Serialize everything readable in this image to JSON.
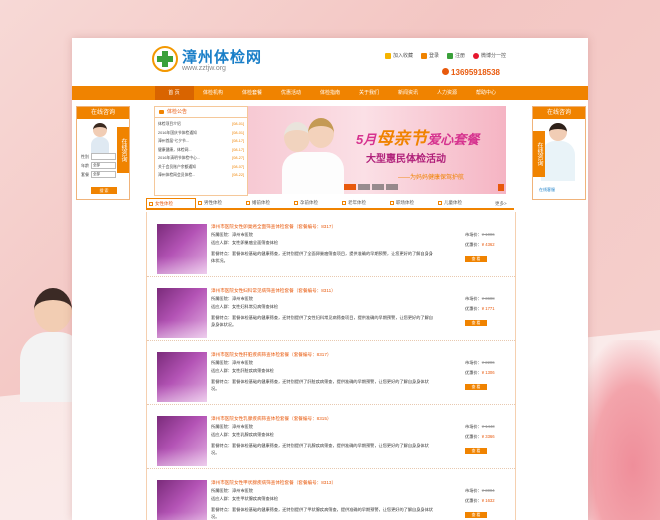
{
  "site": {
    "name": "漳州体检网",
    "url": "www.zztjw.org",
    "hotline": "13695918538",
    "top_links": [
      "加入收藏",
      "登录",
      "注册",
      "微博分一控"
    ]
  },
  "nav": [
    "首 页",
    "体检机构",
    "体检套餐",
    "优惠活动",
    "体检指南",
    "关于我们",
    "新闻资讯",
    "人力资源",
    "帮助中心"
  ],
  "side_left": {
    "title": "在线咨询",
    "tab": "在线咨询",
    "form_labels": [
      "性别",
      "年龄",
      "套餐"
    ],
    "form_values": [
      "",
      "全部",
      "全部"
    ],
    "button": "搜 索"
  },
  "side_right": {
    "title": "在线咨询",
    "tab": "在线咨询",
    "caption": "在线客服"
  },
  "notice": {
    "title": "体检公告",
    "items": [
      {
        "text": "体检项目介绍",
        "date": "[08-01]"
      },
      {
        "text": "2016年国庆节体检通知",
        "date": "[08-01]"
      },
      {
        "text": "漳州首届“七夕节...",
        "date": "[08-17]"
      },
      {
        "text": "健康健康，体检网...",
        "date": "[08-17]"
      },
      {
        "text": "2016年清明节体检中心...",
        "date": "[08-27]"
      },
      {
        "text": "关于会员账户余额通知",
        "date": "[08-07]"
      },
      {
        "text": "漳州体检网会员体检...",
        "date": "[08-22]"
      }
    ]
  },
  "banner": {
    "line1_a": "5月",
    "line1_b": "母亲",
    "line1_c": "节",
    "line1_d": "爱心套餐",
    "line2": "大型惠民体检活动",
    "line3": "——为妈妈健康保驾护航"
  },
  "tabs": [
    "女性体检",
    "男性体检",
    "婚前体检",
    "孕前体检",
    "老年体检",
    "职场体检",
    "儿童体检"
  ],
  "more": "更多>",
  "items": [
    {
      "title": "漳州市医院女性卵巢癌全面筛查体检套餐（套餐编号：8317）",
      "hospital": "所属医院：漳州市医院",
      "people": "适应人群：女性卵巢癌全面筛查体检",
      "desc": "套餐特点：套餐体检基础的健康筛查，还特别提供了全面卵巢癌筛查项目，提供准确的早期预警，让您更好的了解自身身体状况。",
      "price_label": "市场价：",
      "price_orig": "¥ 1006",
      "vip_label": "优惠价：",
      "price_vip": "¥ 4362",
      "btn": "查 看"
    },
    {
      "title": "漳州市医院女性妇科常见病筛查体检套餐（套餐编号：8311）",
      "hospital": "所属医院：漳州市医院",
      "people": "适应人群：女性妇科常见病筛查体检",
      "desc": "套餐特点：套餐体检基础的健康筛查，还特别提供了女性妇科常见病筛查项目，提供准确的早期预警，让您更好的了解自身身体状况。",
      "price_label": "市场价：",
      "price_orig": "¥ 3608",
      "vip_label": "优惠价：",
      "price_vip": "¥ 1771",
      "btn": "查 看"
    },
    {
      "title": "漳州市医院女性肝脏疾病筛查体检套餐（套餐编号：8317）",
      "hospital": "所属医院：漳州市医院",
      "people": "适应人群：女性肝脏疾病筛查体检",
      "desc": "套餐特点：套餐体检基础的健康筛查，还特别提供了肝脏疾病筛查，提供准确的早期预警，让您更好的了解自身身体状况。",
      "price_label": "市场价：",
      "price_orig": "¥ 2206",
      "vip_label": "优惠价：",
      "price_vip": "¥ 1306",
      "btn": "查 看"
    },
    {
      "title": "漳州市医院女性乳腺疾病筛查体检套餐（套餐编号：8315）",
      "hospital": "所属医院：漳州市医院",
      "people": "适应人群：女性乳腺疾病筛查体检",
      "desc": "套餐特点：套餐体检基础的健康筛查，还特别提供了乳腺疾病筛查，提供准确的早期预警，让您更好的了解自身身体状况。",
      "price_label": "市场价：",
      "price_orig": "¥ 1443",
      "vip_label": "优惠价：",
      "price_vip": "¥ 3366",
      "btn": "查 看"
    },
    {
      "title": "漳州市医院女性甲状腺疾病筛查体检套餐（套餐编号：8313）",
      "hospital": "所属医院：漳州市医院",
      "people": "适应人群：女性甲状腺疾病筛查体检",
      "desc": "套餐特点：套餐体检基础的健康筛查，还特别提供了甲状腺疾病筛查，提供准确的早期预警，让您更好的了解自身身体状况。",
      "price_label": "市场价：",
      "price_orig": "¥ 3004",
      "vip_label": "优惠价：",
      "price_vip": "¥ 1632",
      "btn": "查 看"
    }
  ],
  "colors": {
    "accent": "#f08300",
    "brand": "#1a7fc8",
    "highlight": "#e8590c"
  }
}
